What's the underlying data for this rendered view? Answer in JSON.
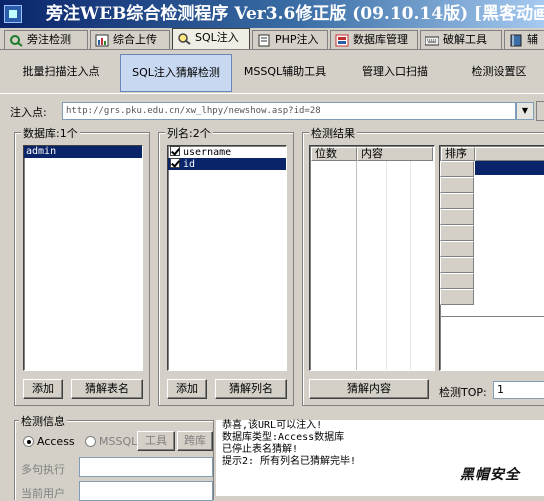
{
  "window": {
    "title": "旁注WEB综合检测程序 Ver3.6修正版 (09.10.14版) [黑客动画吧出"
  },
  "tabs": [
    {
      "label": "旁注检测",
      "icon": "magnifier-icon",
      "active": false
    },
    {
      "label": "综合上传",
      "icon": "chart-icon",
      "active": false
    },
    {
      "label": "SQL注入",
      "icon": "search-icon",
      "active": true
    },
    {
      "label": "PHP注入",
      "icon": "page-icon",
      "active": false
    },
    {
      "label": "数据库管理",
      "icon": "database-icon",
      "active": false
    },
    {
      "label": "破解工具",
      "icon": "keyboard-icon",
      "active": false
    },
    {
      "label": "辅",
      "icon": "book-icon",
      "active": false
    }
  ],
  "toolbar": [
    {
      "label": "批量扫描注入点",
      "active": false
    },
    {
      "label": "SQL注入猜解检测",
      "active": true
    },
    {
      "label": "MSSQL辅助工具",
      "active": false
    },
    {
      "label": "管理入口扫描",
      "active": false
    },
    {
      "label": "检测设置区",
      "active": false
    }
  ],
  "injection": {
    "label": "注入点:",
    "url": "http://grs.pku.edu.cn/xw_lhpy/newshow.asp?id=28"
  },
  "database_panel": {
    "label": "数据库:1个",
    "items": [
      {
        "text": "admin",
        "selected": true
      }
    ],
    "add_label": "添加",
    "guess_label": "猜解表名"
  },
  "columns_panel": {
    "label": "列名:2个",
    "items": [
      {
        "text": "username",
        "checked": true,
        "selected": false
      },
      {
        "text": "id",
        "checked": true,
        "selected": true
      }
    ],
    "add_label": "添加",
    "guess_label": "猜解列名"
  },
  "results_panel": {
    "label": "检测结果",
    "col_position": "位数",
    "col_content": "内容",
    "sort_header": "排序",
    "guess_content_label": "猜解内容",
    "top_label": "检测TOP:",
    "top_value": "1"
  },
  "info_panel": {
    "label": "检测信息",
    "radio_access": "Access",
    "radio_mssql": "MSSQL",
    "tool_btn": "工具",
    "cross_btn": "跨库",
    "multi_exec": "多句执行",
    "current_user": "当前用户"
  },
  "messages": [
    "恭喜,该URL可以注入!",
    "数据库类型:Access数据库",
    "已停止表名猜解!",
    "提示2: 所有列名已猜解完毕!"
  ],
  "watermark": "黑帽安全"
}
